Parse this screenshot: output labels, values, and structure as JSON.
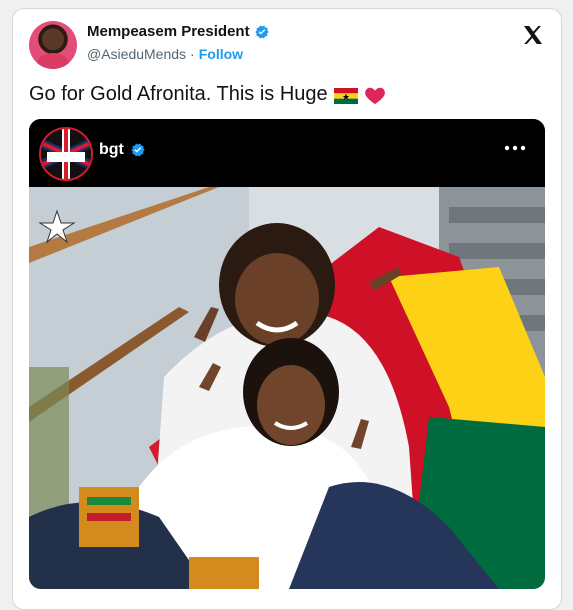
{
  "post": {
    "display_name": "Mempeasem President",
    "handle": "@AsieduMends",
    "separator": "·",
    "follow_label": "Follow",
    "text": "Go for Gold Afronita. This is Huge"
  },
  "embed": {
    "account_name": "bgt",
    "logo_text": "BRITAIN'S GOT TALENT"
  },
  "icons": {
    "verified": "verified-badge-icon",
    "x_logo": "x-logo-icon",
    "flag": "ghana-flag-icon",
    "heart": "red-heart-icon",
    "more": "more-dots-icon",
    "star": "star-icon"
  },
  "colors": {
    "accent": "#1d9bf0",
    "heart": "#e0245e"
  }
}
